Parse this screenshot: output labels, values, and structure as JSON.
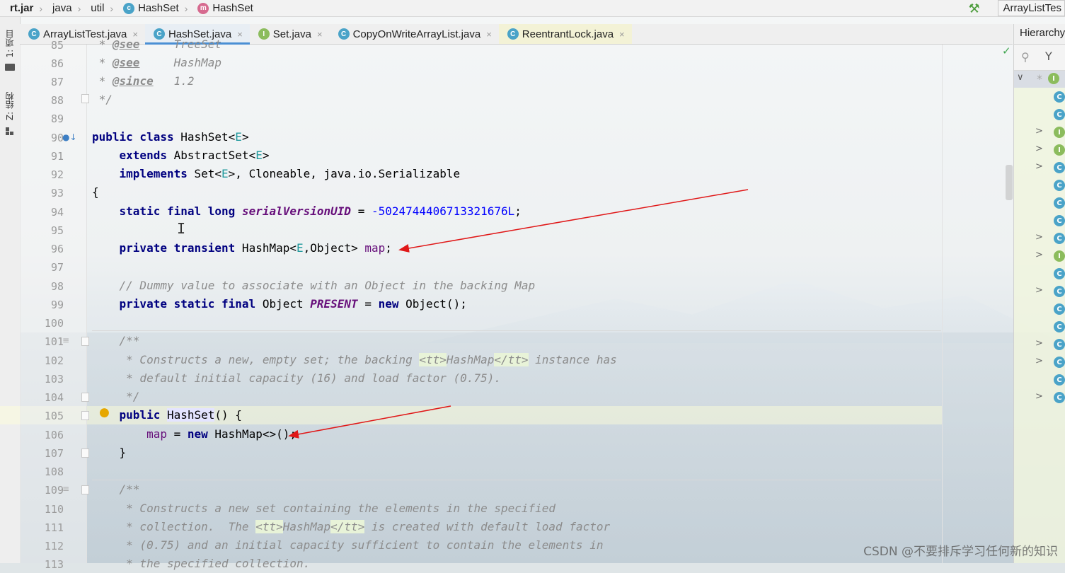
{
  "breadcrumb": {
    "items": [
      {
        "label": "rt.jar",
        "icon": ""
      },
      {
        "label": "java",
        "icon": ""
      },
      {
        "label": "util",
        "icon": ""
      },
      {
        "label": "HashSet",
        "icon": "class-icon"
      },
      {
        "label": "HashSet",
        "icon": "method-icon"
      }
    ],
    "run_config": "ArrayListTes"
  },
  "left_strip": {
    "project_label": "1: 项目",
    "structure_label": "Z: 结构"
  },
  "tabs": [
    {
      "label": "ArrayListTest.java",
      "icon": "C",
      "close": "×"
    },
    {
      "label": "HashSet.java",
      "icon": "C",
      "close": "×"
    },
    {
      "label": "Set.java",
      "icon": "I",
      "close": "×"
    },
    {
      "label": "CopyOnWriteArrayList.java",
      "icon": "C",
      "close": "×"
    },
    {
      "label": "ReentrantLock.java",
      "icon": "C",
      "close": "×"
    }
  ],
  "hierarchy_panel": {
    "title": "Hierarchy",
    "rows": [
      {
        "chevron": "",
        "icon": "C"
      },
      {
        "chevron": "",
        "icon": "C"
      },
      {
        "chevron": ">",
        "icon": "I"
      },
      {
        "chevron": ">",
        "icon": "I"
      },
      {
        "chevron": ">",
        "icon": "C"
      },
      {
        "chevron": "",
        "icon": "C"
      },
      {
        "chevron": "",
        "icon": "C"
      },
      {
        "chevron": "",
        "icon": "C"
      },
      {
        "chevron": ">",
        "icon": "C"
      },
      {
        "chevron": ">",
        "icon": "I"
      },
      {
        "chevron": "",
        "icon": "C"
      },
      {
        "chevron": ">",
        "icon": "C"
      },
      {
        "chevron": "",
        "icon": "C"
      },
      {
        "chevron": "",
        "icon": "C"
      },
      {
        "chevron": ">",
        "icon": "C"
      },
      {
        "chevron": ">",
        "icon": "C"
      },
      {
        "chevron": "",
        "icon": "C"
      },
      {
        "chevron": ">",
        "icon": "C"
      }
    ]
  },
  "code": {
    "line_numbers": [
      "85",
      "86",
      "87",
      "88",
      "89",
      "90",
      "91",
      "92",
      "93",
      "94",
      "95",
      "96",
      "97",
      "98",
      "99",
      "100",
      "101",
      "102",
      "103",
      "104",
      "105",
      "106",
      "107",
      "108",
      "109",
      "110",
      "111",
      "112",
      "113"
    ],
    "l85": {
      "star": " * ",
      "tag": "@see",
      "rest": "     TreeSet"
    },
    "l86": {
      "star": " * ",
      "tag": "@see",
      "rest": "     HashMap"
    },
    "l87": {
      "star": " * ",
      "tag": "@since",
      "rest": "   1.2"
    },
    "l88": {
      "text": " */"
    },
    "l90": {
      "kw1": "public class",
      "name": " HashSet<",
      "tp": "E",
      "end": ">"
    },
    "l91": {
      "indent": "    ",
      "kw": "extends",
      "name": " AbstractSet<",
      "tp": "E",
      "end": ">"
    },
    "l92": {
      "indent": "    ",
      "kw": "implements",
      "name": " Set<",
      "tp": "E",
      "end": ">, Cloneable, java.io.Serializable"
    },
    "l93": {
      "text": "{"
    },
    "l94": {
      "indent": "    ",
      "kw": "static final long",
      "sp": " ",
      "field": "serialVersionUID",
      "eq": " = ",
      "num": "-5024744406713321676L",
      "end": ";"
    },
    "l96": {
      "indent": "    ",
      "kw": "private transient",
      "type": " HashMap<",
      "tp": "E",
      "type2": ",Object> ",
      "field": "map",
      "end": ";"
    },
    "l98": {
      "text": "    // Dummy value to associate with an Object in the backing Map"
    },
    "l99": {
      "indent": "    ",
      "kw": "private static final",
      "type": " Object ",
      "field": "PRESENT",
      "eq": " = ",
      "kw2": "new",
      "end": " Object();"
    },
    "l101": {
      "text": "    /**"
    },
    "l102": {
      "pre": "     * Constructs a new, empty set; the backing ",
      "tag1": "<tt>",
      "mid": "HashMap",
      "tag2": "</tt>",
      "post": " instance has"
    },
    "l103": {
      "text": "     * default initial capacity (16) and load factor (0.75)."
    },
    "l104": {
      "text": "     */"
    },
    "l105": {
      "indent": "    ",
      "kw": "public",
      "sp": " ",
      "name": "HashSet",
      "end": "() {"
    },
    "l106": {
      "indent": "        ",
      "field": "map",
      "eq": " = ",
      "kw": "new",
      "end": " HashMap<>();"
    },
    "l107": {
      "text": "    }"
    },
    "l109": {
      "text": "    /**"
    },
    "l110": {
      "text": "     * Constructs a new set containing the elements in the specified"
    },
    "l111": {
      "pre": "     * collection.  The ",
      "tag1": "<tt>",
      "mid": "HashMap",
      "tag2": "</tt>",
      "post": " is created with default load factor"
    },
    "l112": {
      "text": "     * (0.75) and an initial capacity sufficient to contain the elements in"
    },
    "l113": {
      "text": "     * the specified collection."
    }
  },
  "watermark": "CSDN @不要排斥学习任何新的知识",
  "colors": {
    "arrow": "#e01818",
    "keyword": "#000080",
    "field": "#660e7a",
    "number": "#0000ff",
    "comment": "#8c8c8c"
  }
}
